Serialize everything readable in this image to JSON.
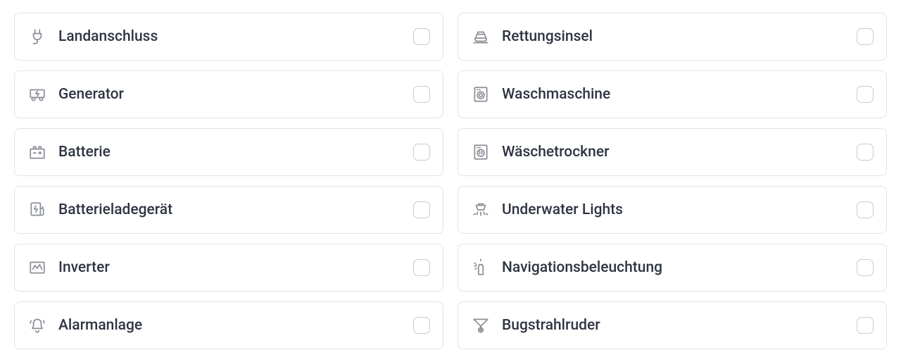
{
  "options_left": [
    {
      "id": "shore-power",
      "icon": "plug-icon",
      "label": "Landanschluss"
    },
    {
      "id": "generator",
      "icon": "generator-icon",
      "label": "Generator"
    },
    {
      "id": "battery",
      "icon": "battery-icon",
      "label": "Batterie"
    },
    {
      "id": "battery-charger",
      "icon": "charger-icon",
      "label": "Batterieladegerät"
    },
    {
      "id": "inverter",
      "icon": "inverter-icon",
      "label": "Inverter"
    },
    {
      "id": "alarm-system",
      "icon": "alarm-icon",
      "label": "Alarmanlage"
    }
  ],
  "options_right": [
    {
      "id": "life-raft",
      "icon": "life-raft-icon",
      "label": "Rettungsinsel"
    },
    {
      "id": "washing-machine",
      "icon": "washer-icon",
      "label": "Waschmaschine"
    },
    {
      "id": "dryer",
      "icon": "dryer-icon",
      "label": "Wäschetrockner"
    },
    {
      "id": "underwater-lights",
      "icon": "underwater-light-icon",
      "label": "Underwater Lights"
    },
    {
      "id": "navigation-lights",
      "icon": "nav-light-icon",
      "label": "Navigationsbeleuchtung"
    },
    {
      "id": "bow-thruster",
      "icon": "bow-thruster-icon",
      "label": "Bugstrahlruder"
    }
  ]
}
